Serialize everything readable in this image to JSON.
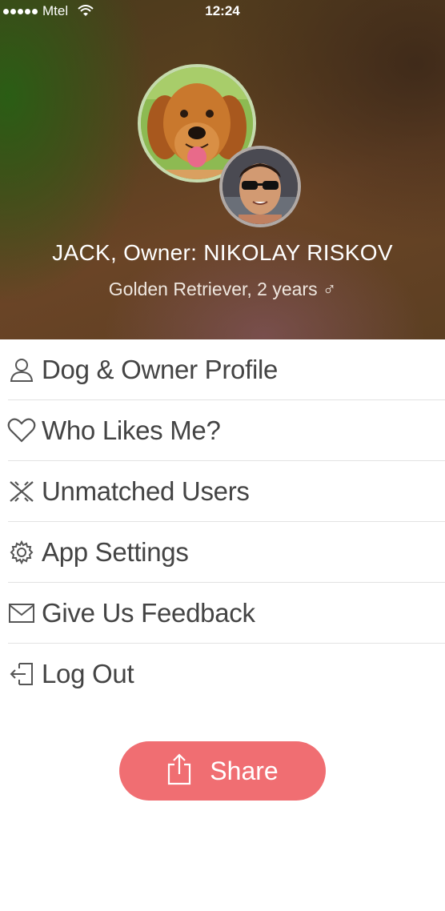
{
  "status_bar": {
    "carrier": "Mtel",
    "time": "12:24"
  },
  "profile": {
    "name_line": "JACK, Owner: NIKOLAY RISKOV",
    "details_line": "Golden Retriever, 2 years ♂"
  },
  "menu": {
    "items": [
      {
        "label": "Dog & Owner Profile",
        "icon": "person-icon"
      },
      {
        "label": "Who Likes Me?",
        "icon": "heart-icon"
      },
      {
        "label": "Unmatched Users",
        "icon": "broken-heart-icon"
      },
      {
        "label": "App Settings",
        "icon": "gear-icon"
      },
      {
        "label": "Give Us Feedback",
        "icon": "envelope-icon"
      },
      {
        "label": "Log Out",
        "icon": "logout-icon"
      }
    ]
  },
  "share": {
    "label": "Share",
    "icon": "share-icon",
    "color": "#f06e72"
  }
}
